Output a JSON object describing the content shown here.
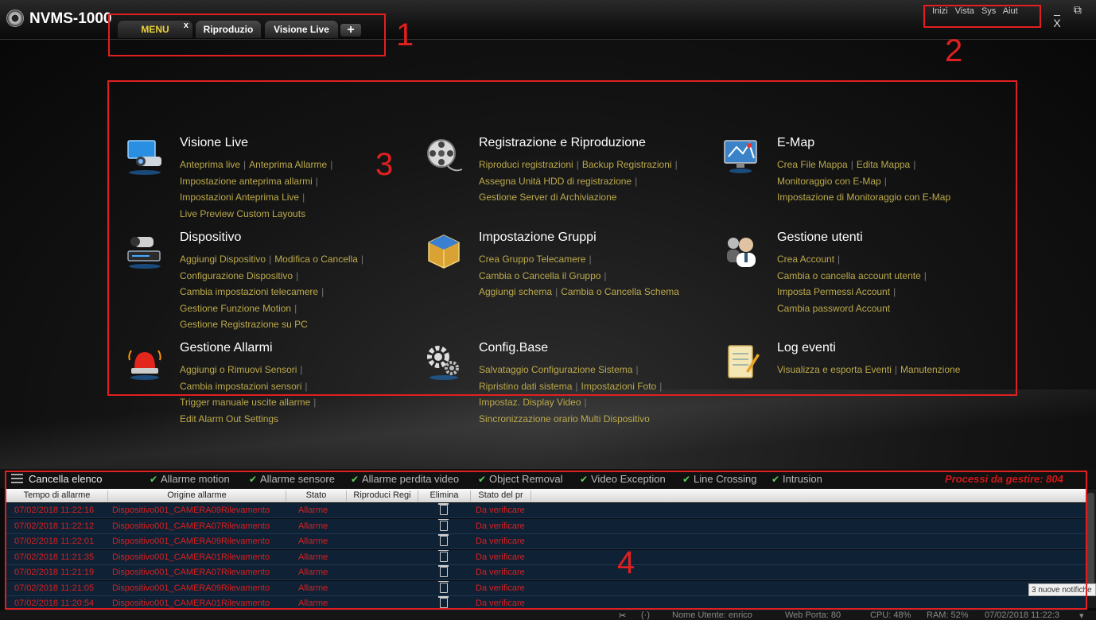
{
  "app": {
    "title": "NVMS-1000"
  },
  "tabs": [
    {
      "label": "MENU",
      "close": "x"
    },
    {
      "label": "Riproduzio"
    },
    {
      "label": "Visione Live"
    },
    {
      "label": "+"
    }
  ],
  "system_menu": [
    "Inizi",
    "Vista",
    "Sys",
    "Aiut"
  ],
  "window_controls": {
    "minimize": "_",
    "restore": "⧉",
    "close": "X"
  },
  "modules": [
    {
      "title": "Visione Live",
      "icon": "monitor-camera-icon",
      "lines": [
        [
          "Anteprima live",
          "Anteprima Allarme"
        ],
        [
          "Impostazione anteprima allarmi"
        ],
        [
          "Impostazioni Anteprima Live"
        ],
        [
          "Live Preview Custom Layouts"
        ]
      ]
    },
    {
      "title": "Registrazione e Riproduzione",
      "icon": "film-reel-icon",
      "lines": [
        [
          "Riproduci registrazioni",
          "Backup Registrazioni"
        ],
        [
          "Assegna Unità HDD di registrazione"
        ],
        [
          "Gestione Server di Archiviazione"
        ]
      ]
    },
    {
      "title": "E-Map",
      "icon": "map-monitor-icon",
      "lines": [
        [
          "Crea File Mappa",
          "Edita Mappa"
        ],
        [
          "Monitoraggio con E-Map"
        ],
        [
          "Impostazione di Monitoraggio con E-Map"
        ]
      ]
    },
    {
      "title": "Dispositivo",
      "icon": "nvr-device-icon",
      "lines": [
        [
          "Aggiungi Dispositivo",
          "Modifica o Cancella"
        ],
        [
          "Configurazione Dispositivo"
        ],
        [
          "Cambia impostazioni telecamere"
        ],
        [
          "Gestione Funzione Motion"
        ],
        [
          "Gestione Registrazione su PC"
        ]
      ]
    },
    {
      "title": "Impostazione Gruppi",
      "icon": "group-cube-icon",
      "lines": [
        [
          "Crea Gruppo Telecamere"
        ],
        [
          "Cambia o Cancella il Gruppo"
        ],
        [
          "Aggiungi schema",
          "Cambia o Cancella Schema"
        ]
      ]
    },
    {
      "title": "Gestione utenti",
      "icon": "users-icon",
      "lines": [
        [
          "Crea Account"
        ],
        [
          "Cambia o cancella account utente"
        ],
        [
          "Imposta Permessi Account"
        ],
        [
          "Cambia password Account"
        ]
      ]
    },
    {
      "title": "Gestione Allarmi",
      "icon": "alarm-siren-icon",
      "lines": [
        [
          "Aggiungi o Rimuovi Sensori"
        ],
        [
          "Cambia impostazioni sensori"
        ],
        [
          "Trigger manuale uscite allarme"
        ],
        [
          "Edit Alarm Out Settings"
        ]
      ]
    },
    {
      "title": "Config.Base",
      "icon": "gears-icon",
      "lines": [
        [
          "Salvataggio Configurazione Sistema"
        ],
        [
          "Ripristino dati sistema",
          "Impostazioni Foto"
        ],
        [
          "Impostaz. Display Video"
        ],
        [
          "Sincronizzazione orario Multi Dispositivo"
        ]
      ]
    },
    {
      "title": "Log eventi",
      "icon": "notepad-icon",
      "lines": [
        [
          "Visualizza e esporta Eventi",
          "Manutenzione"
        ]
      ]
    }
  ],
  "alarm_panel": {
    "clear_label": "Cancella elenco",
    "filters": [
      "Allarme motion",
      "Allarme sensore",
      "Allarme perdita video",
      "Object Removal",
      "Video Exception",
      "Line Crossing",
      "Intrusion"
    ],
    "pending": "Processi da gestire: 804",
    "columns": [
      "Tempo di allarme",
      "Origine allarme",
      "Stato",
      "Riproduci Regi",
      "Elimina",
      "Stato del pr"
    ],
    "rows": [
      {
        "time": "07/02/2018 11:22:16",
        "source": "Dispositivo001_CAMERA09Rilevamento",
        "state": "Allarme",
        "status": "Da verificare"
      },
      {
        "time": "07/02/2018 11:22:12",
        "source": "Dispositivo001_CAMERA07Rilevamento",
        "state": "Allarme",
        "status": "Da verificare"
      },
      {
        "time": "07/02/2018 11:22:01",
        "source": "Dispositivo001_CAMERA09Rilevamento",
        "state": "Allarme",
        "status": "Da verificare"
      },
      {
        "time": "07/02/2018 11:21:35",
        "source": "Dispositivo001_CAMERA01Rilevamento",
        "state": "Allarme",
        "status": "Da verificare"
      },
      {
        "time": "07/02/2018 11:21:19",
        "source": "Dispositivo001_CAMERA07Rilevamento",
        "state": "Allarme",
        "status": "Da verificare"
      },
      {
        "time": "07/02/2018 11:21:05",
        "source": "Dispositivo001_CAMERA09Rilevamento",
        "state": "Allarme",
        "status": "Da verificare"
      },
      {
        "time": "07/02/2018 11:20:54",
        "source": "Dispositivo001_CAMERA01Rilevamento",
        "state": "Allarme",
        "status": "Da verificare"
      }
    ]
  },
  "notification": "3 nuove notifiche",
  "statusbar": {
    "user": "Nome Utente: enrico",
    "web_port": "Web Porta: 80",
    "cpu": "CPU: 48%",
    "ram": "RAM: 52%",
    "datetime": "07/02/2018 11:22:3"
  },
  "annotations": [
    "1",
    "2",
    "3",
    "4"
  ]
}
